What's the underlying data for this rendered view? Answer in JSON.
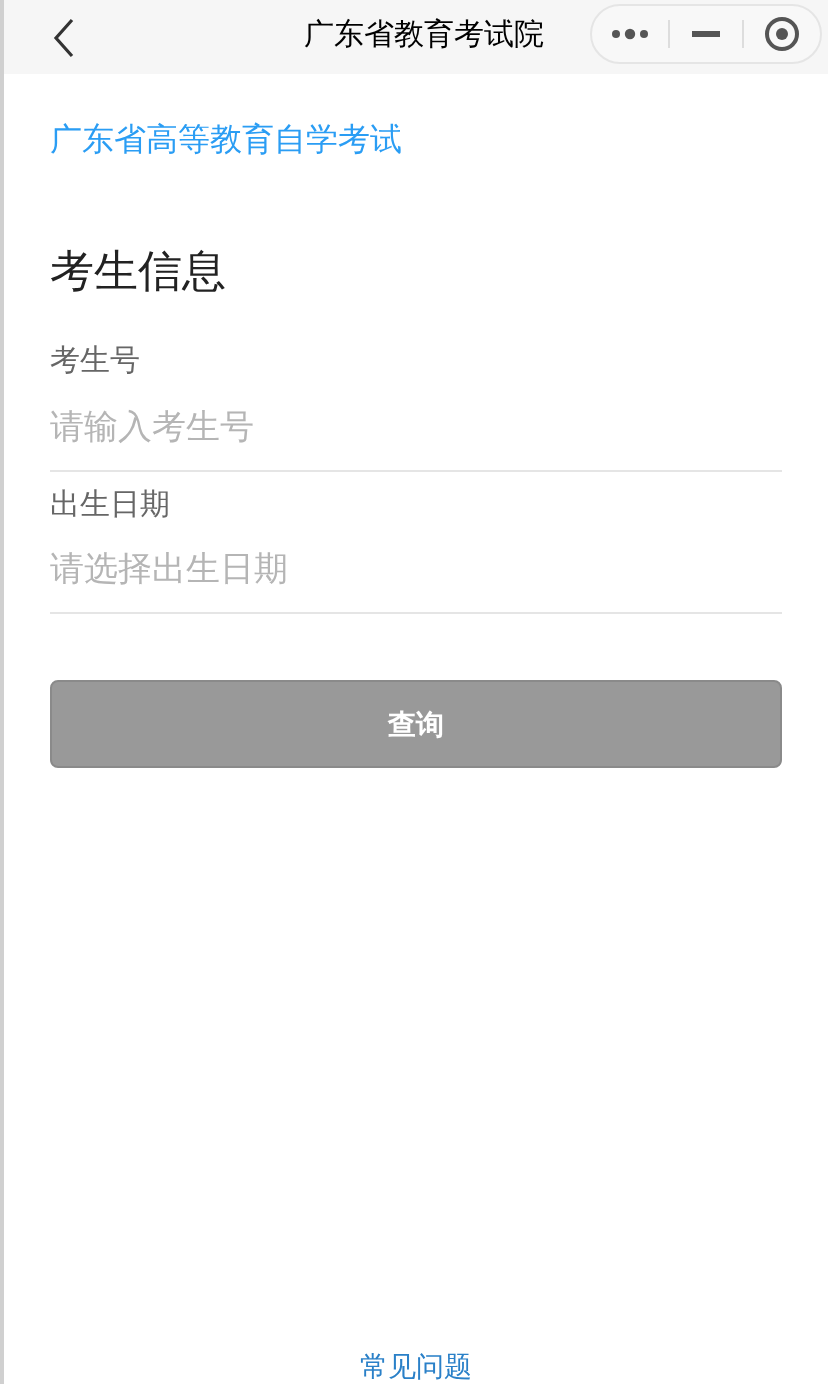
{
  "nav_bar": {
    "title": "广东省教育考试院"
  },
  "link": "广东省高等教育自学考试",
  "section_title": "考生信息",
  "fields": [
    {
      "label": "考生号",
      "placeholder": "请输入考生号"
    },
    {
      "label": "出生日期",
      "placeholder": "请选择出生日期"
    }
  ],
  "submit_button": {
    "label": "查询",
    "disabled": true
  },
  "footer_link": "常见问题"
}
